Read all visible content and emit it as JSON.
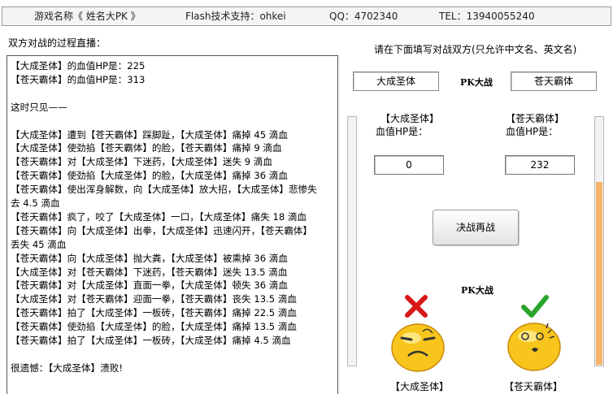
{
  "header": {
    "game_name": "游戏名称《 姓名大PK 》",
    "flash_support": "Flash技术支持：ohkei",
    "qq": "QQ：4702340",
    "tel": "TEL：13940055240"
  },
  "log_section": {
    "title": "双方对战的过程直播：",
    "lines": [
      "【大成圣体】的血值HP是：225",
      "【苍天霸体】的血值HP是：313",
      "",
      "这时只见——",
      "",
      "【大成圣体】遭到【苍天霸体】踩脚趾，【大成圣体】痛掉 45 滴血",
      "【大成圣体】使劲掐【苍天霸体】的脸，【苍天霸体】痛掉 9 滴血",
      "【苍天霸体】对【大成圣体】下迷药，【大成圣体】迷失 9 滴血",
      "【苍天霸体】使劲掐【大成圣体】的脸，【大成圣体】痛掉 36 滴血",
      "【苍天霸体】使出浑身解数，向【大成圣体】放大招，【大成圣体】悲惨失",
      "去 4.5 滴血",
      "【苍天霸体】疯了，咬了【大成圣体】一口，【大成圣体】痛失 18 滴血",
      "【苍天霸体】向【大成圣体】出拳，【大成圣体】迅速闪开，【苍天霸体】",
      "丢失 45 滴血",
      "【苍天霸体】向【大成圣体】抛大粪，【大成圣体】被熏掉 36 滴血",
      "【大成圣体】对【苍天霸体】下迷药，【苍天霸体】迷失 13.5 滴血",
      "【苍天霸体】对【大成圣体】直面一拳，【大成圣体】顿失 36 滴血",
      "【大成圣体】对【苍天霸体】迎面一拳，【苍天霸体】丧失 13.5 滴血",
      "【苍天霸体】拍了【大成圣体】一板砖，【苍天霸体】痛掉 22.5 滴血",
      "【苍天霸体】使劲掐【大成圣体】的脸，【大成圣体】痛掉 13.5 滴血",
      "【苍天霸体】拍了【大成圣体】一板砖，【大成圣体】痛掉 4.5 滴血",
      "",
      "很遗憾：【大成圣体】溃败!"
    ]
  },
  "setup": {
    "instruction": "请在下面填写对战双方(只允许中文名、英文名)",
    "player1_name": "大成圣体",
    "player2_name": "苍天霸体",
    "pk_label": "PK大战",
    "player1_tag": "【大成圣体】",
    "player2_tag": "【苍天霸体】",
    "hp_label": "血值HP是：",
    "player1_hp": "0",
    "player2_hp": "232",
    "rematch_button": "决战再战",
    "pk_label_bottom": "PK大战",
    "player1_bottom": "【大成圣体】",
    "player2_bottom": "【苍天霸体】"
  },
  "health_bars": {
    "player1_fraction": 0,
    "player2_fraction": 0.74
  },
  "colors": {
    "loser_mark": "#d81818",
    "winner_mark": "#2aa52a",
    "face": "#f7c51c",
    "hp_fill": "#f5b36a"
  },
  "icons": {
    "loser": "x-mark-icon",
    "winner": "check-mark-icon"
  }
}
